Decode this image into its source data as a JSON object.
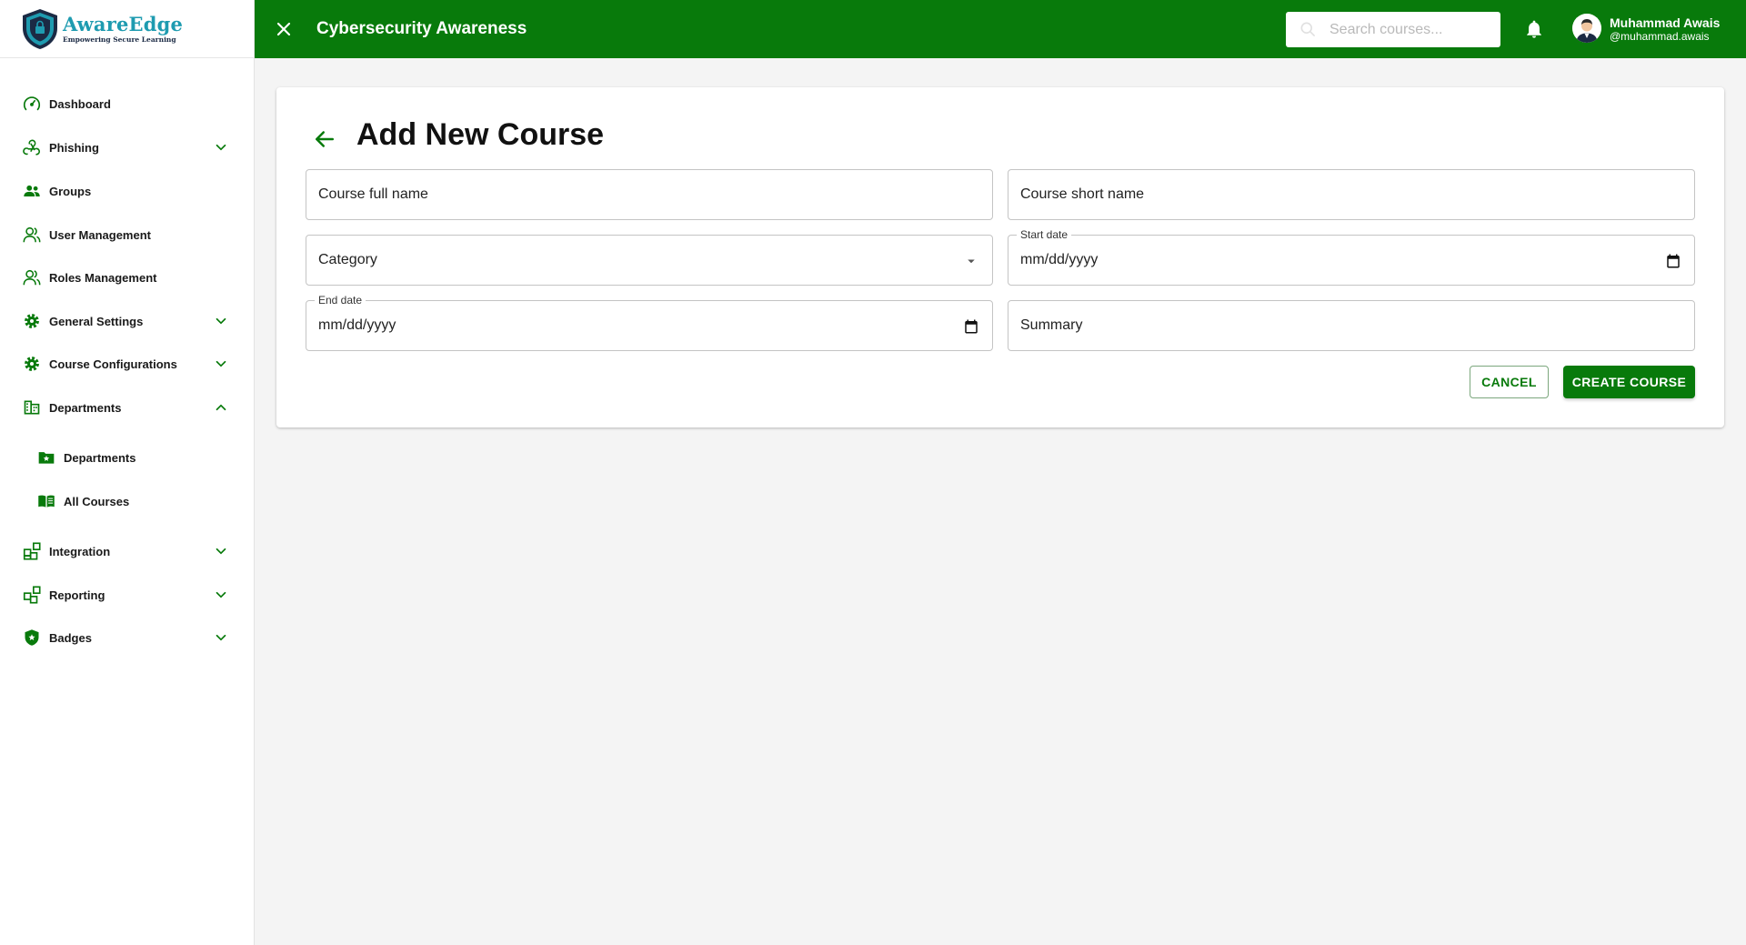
{
  "brand": {
    "name": "AwareEdge",
    "tagline": "Empowering Secure Learning",
    "accent": "#087a0b",
    "logo_text_color": "#1e9bb0"
  },
  "sidebar": {
    "items": [
      {
        "label": "Dashboard",
        "icon": "speedometer-icon"
      },
      {
        "label": "Phishing",
        "icon": "webhook-icon",
        "chevron": "down"
      },
      {
        "label": "Groups",
        "icon": "people-icon"
      },
      {
        "label": "User Management",
        "icon": "person-outline-icon"
      },
      {
        "label": "Roles Management",
        "icon": "people-outline-icon"
      },
      {
        "label": "General Settings",
        "icon": "gear-icon",
        "chevron": "down"
      },
      {
        "label": "Course Configurations",
        "icon": "gear-icon",
        "chevron": "down"
      },
      {
        "label": "Departments",
        "icon": "building-icon",
        "chevron": "up"
      },
      {
        "label": "Departments",
        "icon": "folder-star-icon",
        "sub": true
      },
      {
        "label": "All Courses",
        "icon": "book-icon",
        "sub": true
      },
      {
        "label": "Integration",
        "icon": "widgets-icon",
        "chevron": "down"
      },
      {
        "label": "Reporting",
        "icon": "widgets-icon",
        "chevron": "down"
      },
      {
        "label": "Badges",
        "icon": "shield-check-icon",
        "chevron": "down"
      }
    ]
  },
  "topbar": {
    "title": "Cybersecurity Awareness",
    "search_placeholder": "Search courses...",
    "user_name": "Muhammad Awais",
    "user_handle": "@muhammad.awais"
  },
  "form": {
    "title": "Add New Course",
    "full_name_placeholder": "Course full name",
    "short_name_placeholder": "Course short name",
    "category_placeholder": "Category",
    "start_date_label": "Start date",
    "start_date_value": "mm/dd/yyyy",
    "end_date_label": "End date",
    "end_date_value": "mm/dd/yyyy",
    "summary_placeholder": "Summary",
    "cancel_label": "CANCEL",
    "create_label": "CREATE COURSE"
  }
}
